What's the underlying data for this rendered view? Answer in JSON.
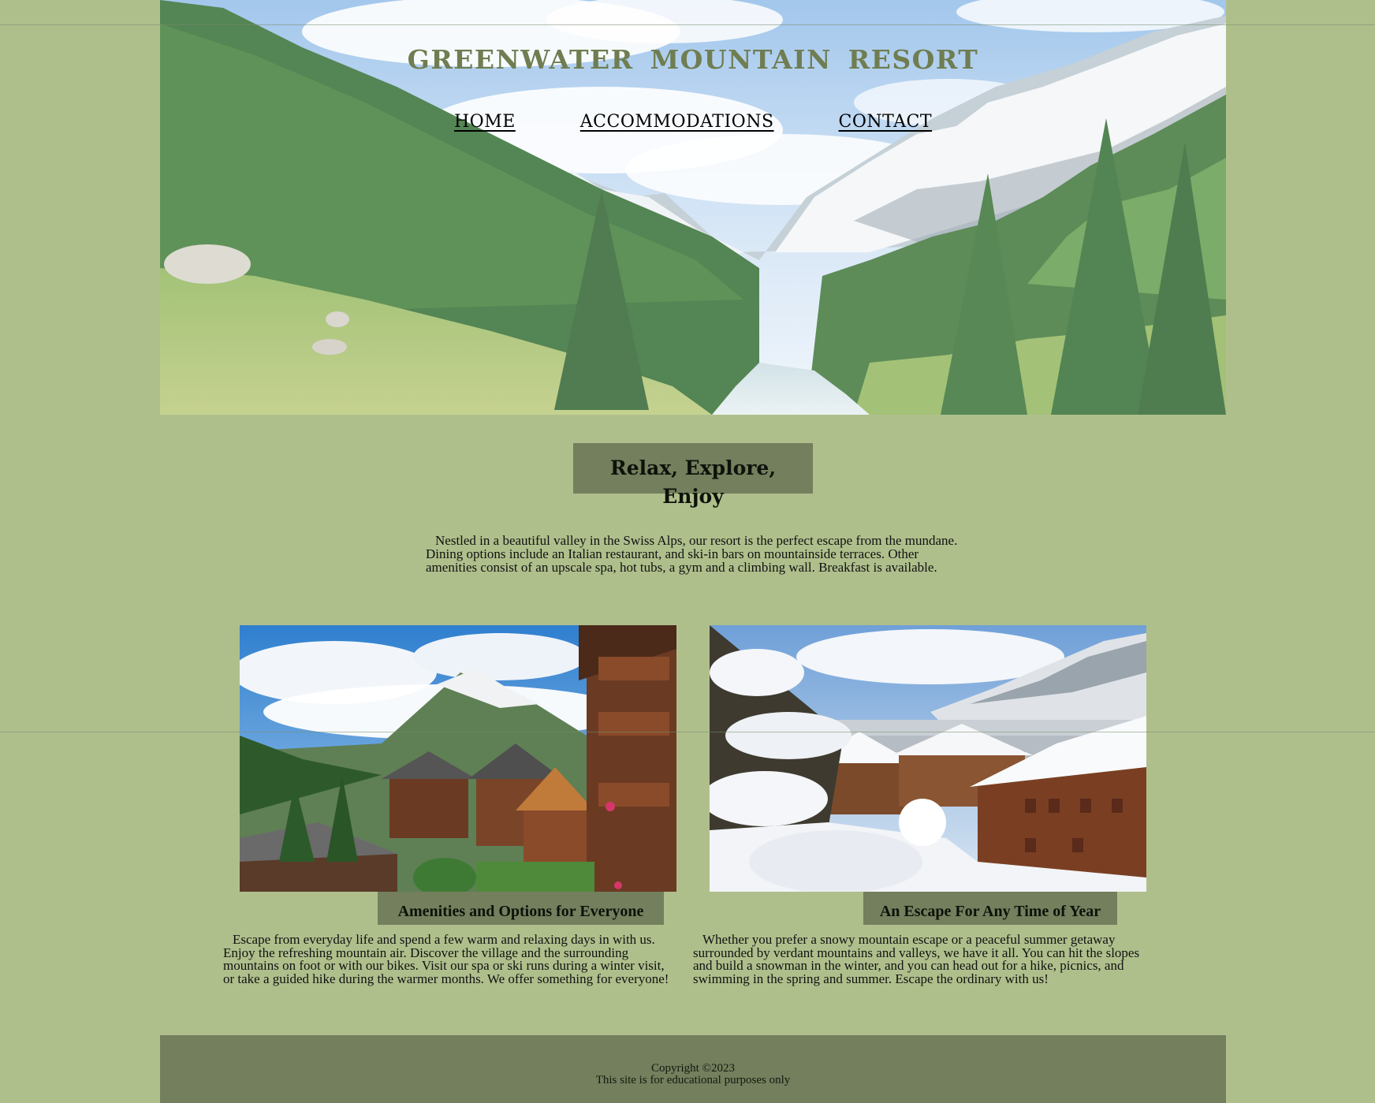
{
  "site": {
    "title": "GREENWATER MOUNTAIN RESORT"
  },
  "nav": {
    "items": [
      {
        "label": "HOME"
      },
      {
        "label": "ACCOMMODATIONS"
      },
      {
        "label": "CONTACT"
      }
    ]
  },
  "tagline": "Relax, Explore, Enjoy",
  "intro": "Nestled in a beautiful valley in the Swiss Alps, our resort is the perfect escape from the mundane. Dining options include an Italian restaurant, and ski-in bars on mountainside terraces. Other amenities consist of an upscale spa, hot tubs, a gym and a climbing wall. Breakfast is available.",
  "features": [
    {
      "heading": "Amenities and Options for Everyone",
      "text": "Escape from everyday life and spend a few warm and relaxing days in with us. Enjoy the refreshing mountain air. Discover the village and the surrounding mountains on foot or with our bikes. Visit our spa or ski runs during a winter visit, or take a guided hike during the warmer months. We offer something for everyone!"
    },
    {
      "heading": "An Escape For Any Time of Year",
      "text": "Whether you prefer a snowy mountain escape or a peaceful summer getaway surrounded by verdant mountains and valleys, we have it all. You can hit the slopes and build a snowman in the winter, and you can head out for a hike, picnics, and swimming in the spring and summer. Escape the ordinary with us!"
    }
  ],
  "footer": {
    "copyright": "Copyright ©2023",
    "note": "This site is for educational purposes only"
  },
  "colors": {
    "page_background": "#afbf8c",
    "accent_box": "#737f5d",
    "title_color": "#6f7d51"
  }
}
